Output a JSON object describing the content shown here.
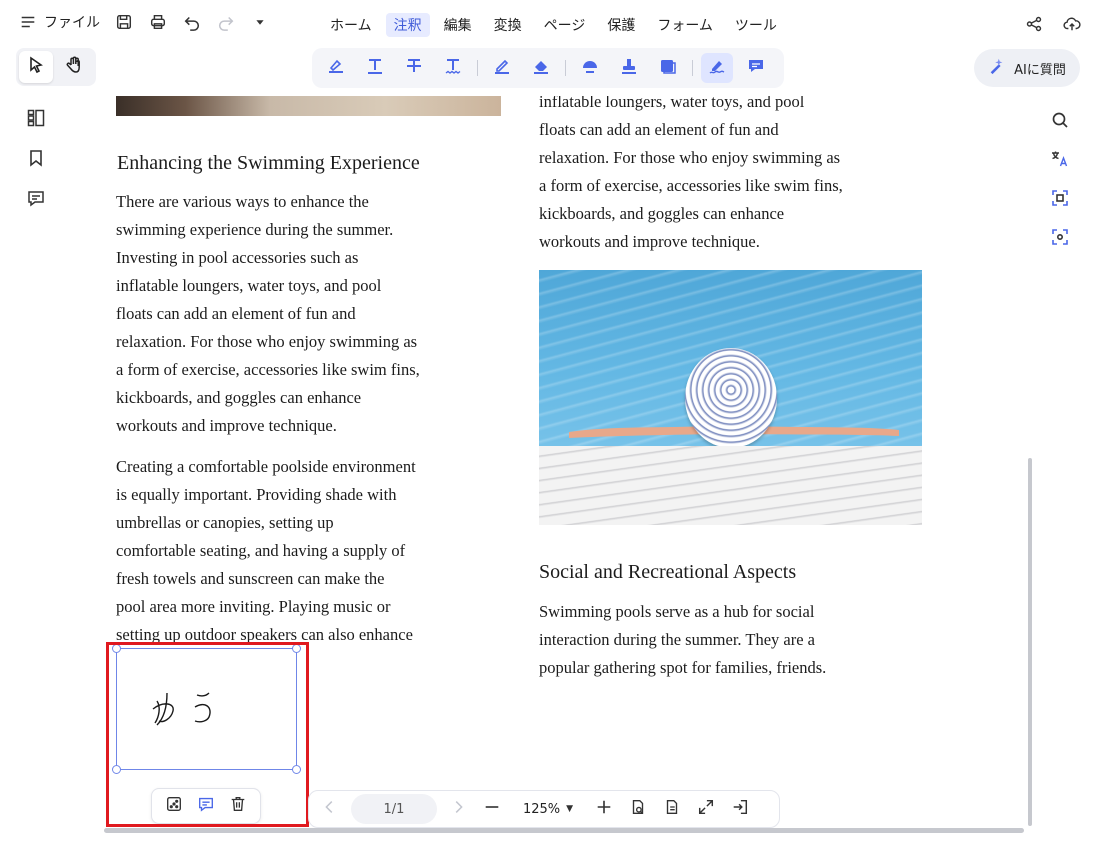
{
  "menubar": {
    "file_label": "ファイル",
    "tabs": [
      {
        "label": "ホーム",
        "active": false
      },
      {
        "label": "注釈",
        "active": true
      },
      {
        "label": "編集",
        "active": false
      },
      {
        "label": "変換",
        "active": false
      },
      {
        "label": "ページ",
        "active": false
      },
      {
        "label": "保護",
        "active": false
      },
      {
        "label": "フォーム",
        "active": false
      },
      {
        "label": "ツール",
        "active": false
      }
    ],
    "icons": [
      "hamburger-icon",
      "save-icon",
      "print-icon",
      "undo-icon",
      "redo-icon",
      "dropdown-icon",
      "share-icon",
      "cloud-upload-icon"
    ]
  },
  "tool_toggle": {
    "active": "select",
    "items": [
      "cursor-icon",
      "hand-icon"
    ]
  },
  "annotation_toolbar": {
    "icons": [
      "highlight-icon",
      "underline-text-icon",
      "strikethrough-text-icon",
      "squiggly-text-icon",
      "pencil-icon",
      "eraser-icon",
      "shape-icon",
      "stamp-icon",
      "attachment-icon",
      "signature-icon",
      "note-icon"
    ],
    "active": "signature-icon",
    "accent": "#4a67e8"
  },
  "ai_button": {
    "label": "AIに質問"
  },
  "left_panel": {
    "icons": [
      "thumbnails-icon",
      "bookmark-icon",
      "comment-icon"
    ]
  },
  "right_panel": {
    "icons": [
      "search-icon",
      "translate-icon",
      "ocr-icon",
      "screen-capture-icon"
    ]
  },
  "document": {
    "left_column": {
      "heading": "Enhancing the Swimming Experience",
      "para1": [
        "There are various ways to enhance the",
        "swimming experience during the summer.",
        "Investing in pool accessories such as",
        "inflatable loungers, water toys, and pool",
        "floats can add an element of fun and",
        "relaxation. For those who enjoy swimming as",
        "a form of exercise, accessories like swim fins,",
        "kickboards, and goggles can enhance",
        "workouts and improve technique."
      ],
      "para2": [
        "Creating a comfortable poolside environment",
        "is equally important. Providing shade with",
        "umbrellas or canopies, setting up",
        "comfortable seating, and having a supply of",
        "fresh towels and sunscreen can make the",
        "pool area more inviting. Playing music or",
        "setting up outdoor speakers can also enhance"
      ]
    },
    "right_column": {
      "para_top": [
        "inflatable loungers, water toys, and pool",
        "floats can add an element of fun and",
        "relaxation. For those who enjoy swimming as",
        "a form of exercise, accessories like swim fins,",
        "kickboards, and goggles can enhance",
        "workouts and improve technique."
      ],
      "heading": "Social and Recreational Aspects",
      "para": [
        "Swimming pools serve as a hub for social",
        "interaction during the summer. They are a",
        "popular gathering spot for families, friends."
      ]
    }
  },
  "signature": {
    "text": "ゆう",
    "toolbar_icons": [
      "properties-icon",
      "comment-icon",
      "delete-icon"
    ],
    "highlight_color": "#e0191f",
    "selection_color": "#6f86e8"
  },
  "page_nav": {
    "page": "1/1",
    "zoom": "125%",
    "icons": [
      "prev-page-icon",
      "next-page-icon",
      "zoom-out-icon",
      "zoom-in-icon",
      "view-mode-icon",
      "page-layout-icon",
      "fullscreen-icon",
      "exit-icon"
    ]
  }
}
